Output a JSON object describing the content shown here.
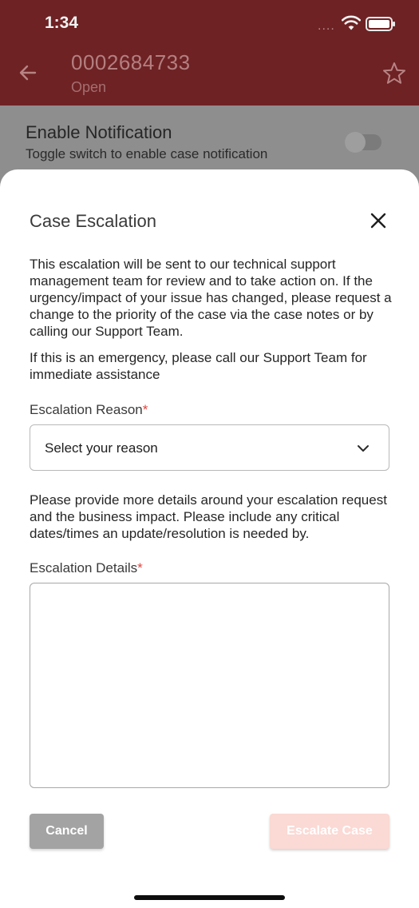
{
  "status_bar": {
    "time": "1:34",
    "signal_dots": "....",
    "wifi_icon": "wifi-icon",
    "battery_icon": "battery-icon"
  },
  "header": {
    "case_number": "0002684733",
    "case_status": "Open",
    "back_icon": "arrow-left-icon",
    "favorite_icon": "star-outline-icon"
  },
  "notification": {
    "title": "Enable Notification",
    "subtitle": "Toggle switch to enable case notification",
    "enabled": false
  },
  "modal": {
    "title": "Case Escalation",
    "close_icon": "close-icon",
    "intro": "This escalation will be sent to our technical support management team for review and to take action on. If the urgency/impact of your issue has changed, please request a change to the priority of the case via the case notes or by calling our Support Team.",
    "emergency": "If this is an emergency, please call our Support Team for immediate assistance",
    "reason_label": "Escalation Reason",
    "required_mark": "*",
    "reason_value": "Select your reason",
    "details_prompt": "Please provide more details around your escalation request and the business impact. Please include any critical dates/times an update/resolution is needed by.",
    "details_label": "Escalation Details",
    "details_value": "",
    "cancel_label": "Cancel",
    "escalate_label": "Escalate Case"
  },
  "colors": {
    "header": "#6e2224",
    "required": "#e0463f",
    "cancel_button": "#a3a3a3",
    "escalate_button_disabled": "#fbd9d4"
  }
}
